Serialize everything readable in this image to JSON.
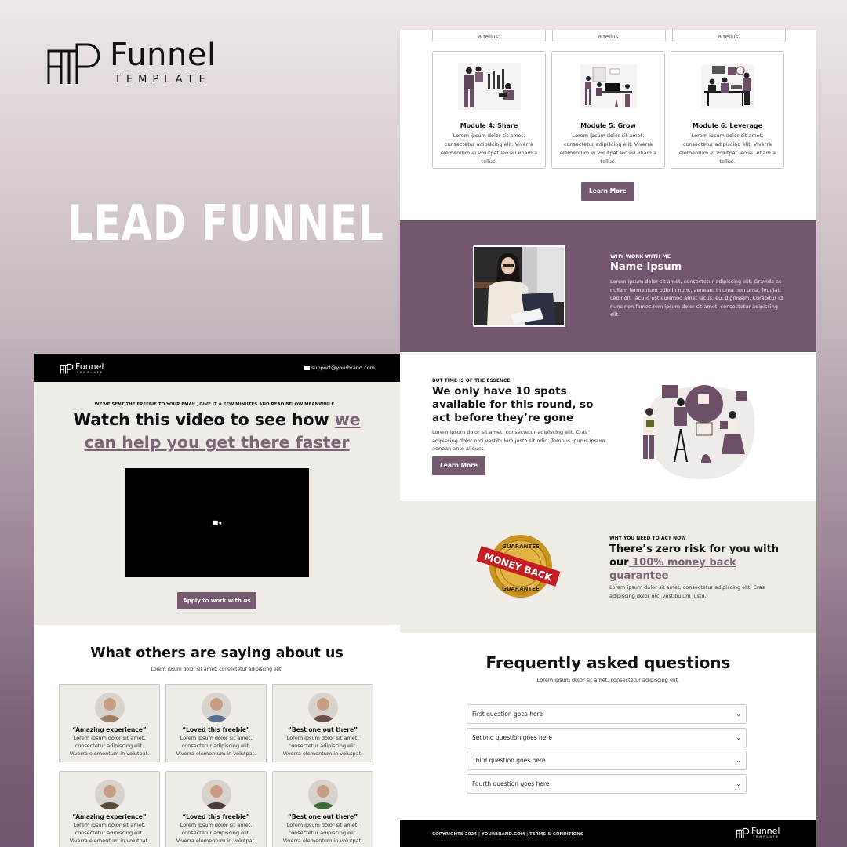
{
  "brand": {
    "word": "Funnel",
    "sub": "TEMPLATE"
  },
  "hero_title": "LEAD FUNNEL",
  "colors": {
    "accent": "#755a70",
    "beige": "#efebe7",
    "dark": "#000000"
  },
  "right_page": {
    "modules_top_row": [
      {
        "tail": "a tellus."
      },
      {
        "tail": "a tellus."
      },
      {
        "tail": "a tellus."
      }
    ],
    "modules": [
      {
        "title": "Module 4: Share",
        "desc": "Lorem ipsum dolor sit amet, consectetur adipiscing elit. Viverra elementum in volutpat leo eu etiam a tellus.",
        "illustration": "team-chart-illustration"
      },
      {
        "title": "Module 5: Grow",
        "desc": "Lorem ipsum dolor sit amet, consectetur adipiscing elit. Viverra elementum in volutpat leo eu etiam a tellus.",
        "illustration": "office-desk-illustration"
      },
      {
        "title": "Module 6: Leverage",
        "desc": "Lorem ipsum dolor sit amet, consectetur adipiscing elit. Viverra elementum in volutpat leo eu etiam a tellus.",
        "illustration": "meeting-table-illustration"
      }
    ],
    "modules_button": "Learn More",
    "about": {
      "kicker": "WHY WORK WITH ME",
      "name": "Name Ipsum",
      "text": "Lorem ipsum dolor sit amet, consectetur adipiscing elit. Gravida ac nullam fermentum odio in nunc, aenean. In urna non urna, feugiat. Leo non, iaculis est euismod amet lacus, eu, dignissim. Curabitur id nunc non fames.rem ipsum dolor sit amet, consectetur adipiscing elit."
    },
    "essence": {
      "kicker": "BUT TIME IS OF THE ESSENCE",
      "title": "We only have 10 spots available for this round, so act before they’re gone",
      "text": "Lorem ipsum dolor sit amet, consectetur adipiscing elit. Cras adipiscing dolor orci vestibulum justo sit odio. Tempus, purus ipsum aenean ante aliquet.",
      "button": "Learn More"
    },
    "guarantee": {
      "badge_top": "GUARANTEE",
      "badge_ribbon": "MONEY BACK",
      "badge_bottom": "GUARANTEE",
      "kicker": "WHY YOU NEED TO ACT NOW",
      "title_plain": "There’s zero risk for you with our",
      "title_highlight": " 100% money back guarantee",
      "text": "Lorem ipsum dolor sit amet, consectetur adipiscing elit. Cras adipiscing dolor orci vestibulum justo."
    },
    "faq": {
      "title": "Frequently asked questions",
      "subtitle": "Lorem ipsum dolor sit amet, consectetur adipiscing elit.",
      "items": [
        {
          "q": "First question goes here"
        },
        {
          "q": "Second question goes here"
        },
        {
          "q": "Third question goes here"
        },
        {
          "q": "Fourth question goes here"
        }
      ],
      "chevron": "⌄"
    },
    "footer": {
      "text": "COPYRIGHTS 2024 | YOURBRAND.COM | TERMS & CONDITIONS",
      "logo_word": "Funnel",
      "logo_sub": "TEMPLATE"
    }
  },
  "left_page": {
    "nav": {
      "logo_word": "Funnel",
      "logo_sub": "TEMPLATE",
      "email": "support@yourbrand.com"
    },
    "video_section": {
      "kicker": "WE’VE SENT THE FREEBIE TO YOUR EMAIL, GIVE IT A FEW MINUTES AND READ BELOW MEANWHILE...",
      "title_plain": "Watch this video to see how ",
      "title_highlight": "we can help you get there faster",
      "camera_icon": "■◂",
      "button": "Apply to work with us"
    },
    "testimonials": {
      "title": "What others are saying about us",
      "subtitle": "Lorem ipsum dolor sit amet, consectetur adipiscing elit.",
      "items": [
        {
          "quote": "“Amazing experience”",
          "text": "Lorem ipsum dolor sit amet, consectetur adipiscing elit. Viverra elementum in volutpat.",
          "avatar_color": "#a08064"
        },
        {
          "quote": "“Loved this freebie”",
          "text": "Lorem ipsum dolor sit amet, consectetur adipiscing elit. Viverra elementum in volutpat.",
          "avatar_color": "#5a6f8c"
        },
        {
          "quote": "“Best one out there”",
          "text": "Lorem ipsum dolor sit amet, consectetur adipiscing elit. Viverra elementum in volutpat.",
          "avatar_color": "#6b5048"
        },
        {
          "quote": "“Amazing experience”",
          "text": "Lorem ipsum dolor sit amet, consectetur adipiscing elit. Viverra elementum in volutpat.",
          "avatar_color": "#5c4a3a"
        },
        {
          "quote": "“Loved this freebie”",
          "text": "Lorem ipsum dolor sit amet, consectetur adipiscing elit. Viverra elementum in volutpat.",
          "avatar_color": "#4a3c36"
        },
        {
          "quote": "“Best one out there”",
          "text": "Lorem ipsum dolor sit amet, consectetur adipiscing elit. Viverra elementum in volutpat.",
          "avatar_color": "#3f6a3a"
        }
      ]
    }
  }
}
